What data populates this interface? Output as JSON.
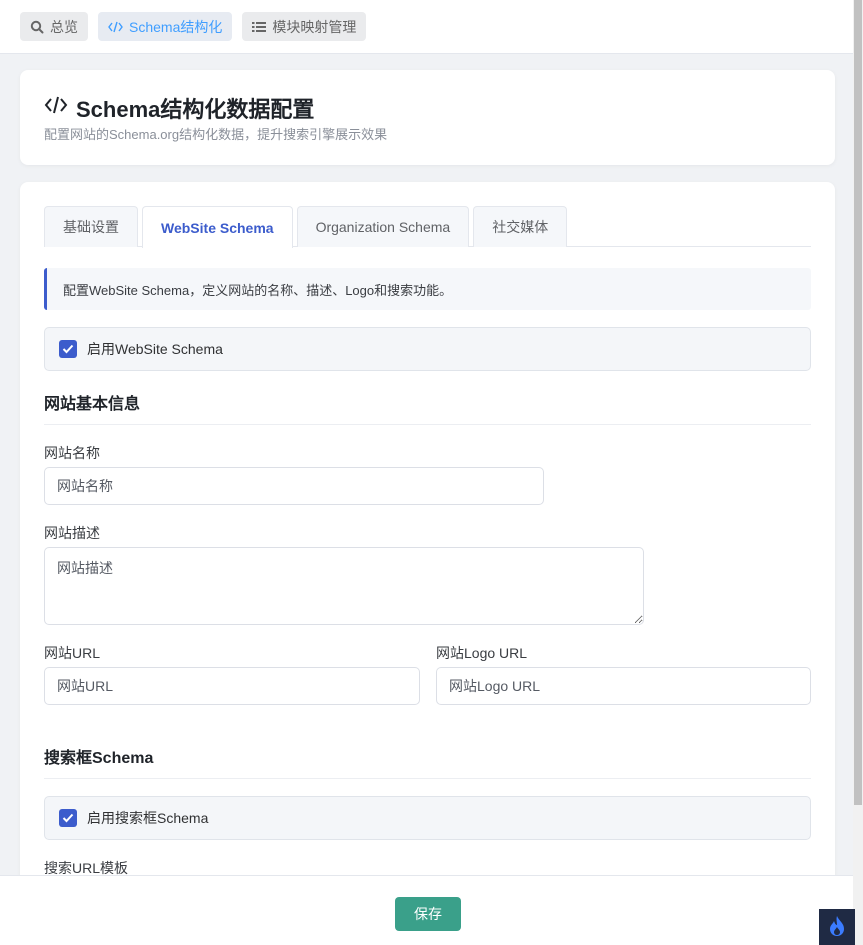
{
  "nav": {
    "items": [
      {
        "label": "总览",
        "icon": "search-icon"
      },
      {
        "label": "Schema结构化",
        "icon": "code-icon"
      },
      {
        "label": "模块映射管理",
        "icon": "list-icon"
      }
    ]
  },
  "header": {
    "title": "Schema结构化数据配置",
    "subtitle": "配置网站的Schema.org结构化数据，提升搜索引擎展示效果"
  },
  "tabs": [
    "基础设置",
    "WebSite Schema",
    "Organization Schema",
    "社交媒体"
  ],
  "info_text": "配置WebSite Schema，定义网站的名称、描述、Logo和搜索功能。",
  "enable_website": {
    "label": "启用WebSite Schema",
    "checked": true
  },
  "section_basic": "网站基本信息",
  "fields": {
    "name": {
      "label": "网站名称",
      "placeholder": "网站名称"
    },
    "description": {
      "label": "网站描述",
      "placeholder": "网站描述"
    },
    "url": {
      "label": "网站URL",
      "placeholder": "网站URL"
    },
    "logo_url": {
      "label": "网站Logo URL",
      "placeholder": "网站Logo URL"
    }
  },
  "section_search": "搜索框Schema",
  "enable_search": {
    "label": "启用搜索框Schema",
    "checked": true
  },
  "search_url_label": "搜索URL模板",
  "footer": {
    "save_label": "保存"
  },
  "colors": {
    "accent": "#3c5ccc",
    "save": "#3aa08a",
    "nav_active": "#409eff"
  }
}
